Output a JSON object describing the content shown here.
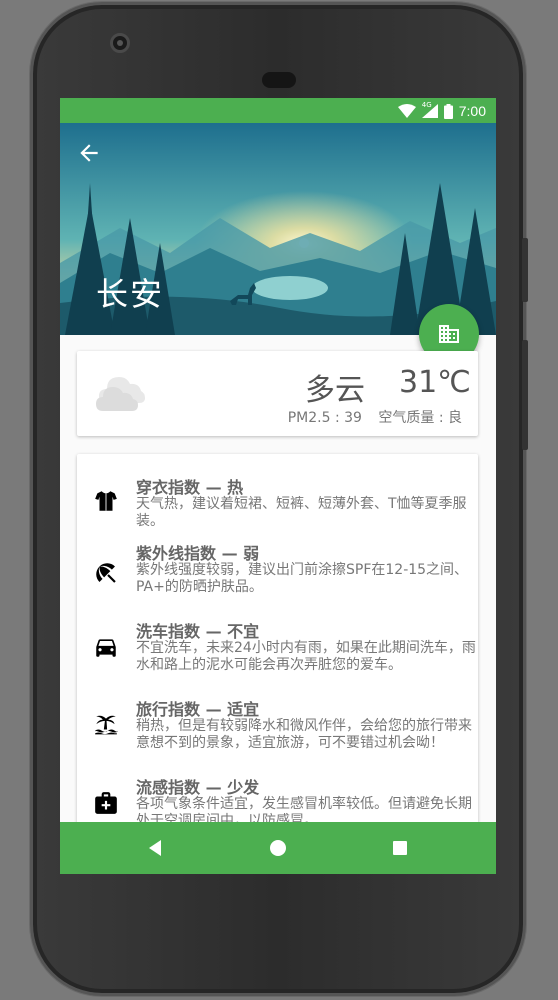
{
  "status_bar": {
    "network": "4G",
    "time": "7:00"
  },
  "header": {
    "city": "长安"
  },
  "weather": {
    "description": "多云",
    "temperature": "31℃",
    "pm25": "PM2.5 : 39",
    "air_quality": "空气质量 : 良"
  },
  "indices": [
    {
      "title": "穿衣指数 — 热",
      "desc": "天气热，建议着短裙、短裤、短薄外套、T恤等夏季服装。",
      "icon": "shirt-icon"
    },
    {
      "title": "紫外线指数 — 弱",
      "desc": "紫外线强度较弱，建议出门前涂擦SPF在12-15之间、PA+的防晒护肤品。",
      "icon": "umbrella-beach-icon"
    },
    {
      "title": "洗车指数 — 不宜",
      "desc": "不宜洗车，未来24小时内有雨，如果在此期间洗车，雨水和路上的泥水可能会再次弄脏您的爱车。",
      "icon": "car-icon"
    },
    {
      "title": "旅行指数 — 适宜",
      "desc": "稍热，但是有较弱降水和微风作伴，会给您的旅行带来意想不到的景象，适宜旅游，可不要错过机会呦！",
      "icon": "palm-tree-icon"
    },
    {
      "title": "流感指数 — 少发",
      "desc": "各项气象条件适宜，发生感冒机率较低。但请避免长期处于空调房间中，以防感冒。",
      "icon": "medical-kit-icon"
    }
  ],
  "colors": {
    "primary": "#4caf50",
    "text_secondary": "#777777"
  }
}
